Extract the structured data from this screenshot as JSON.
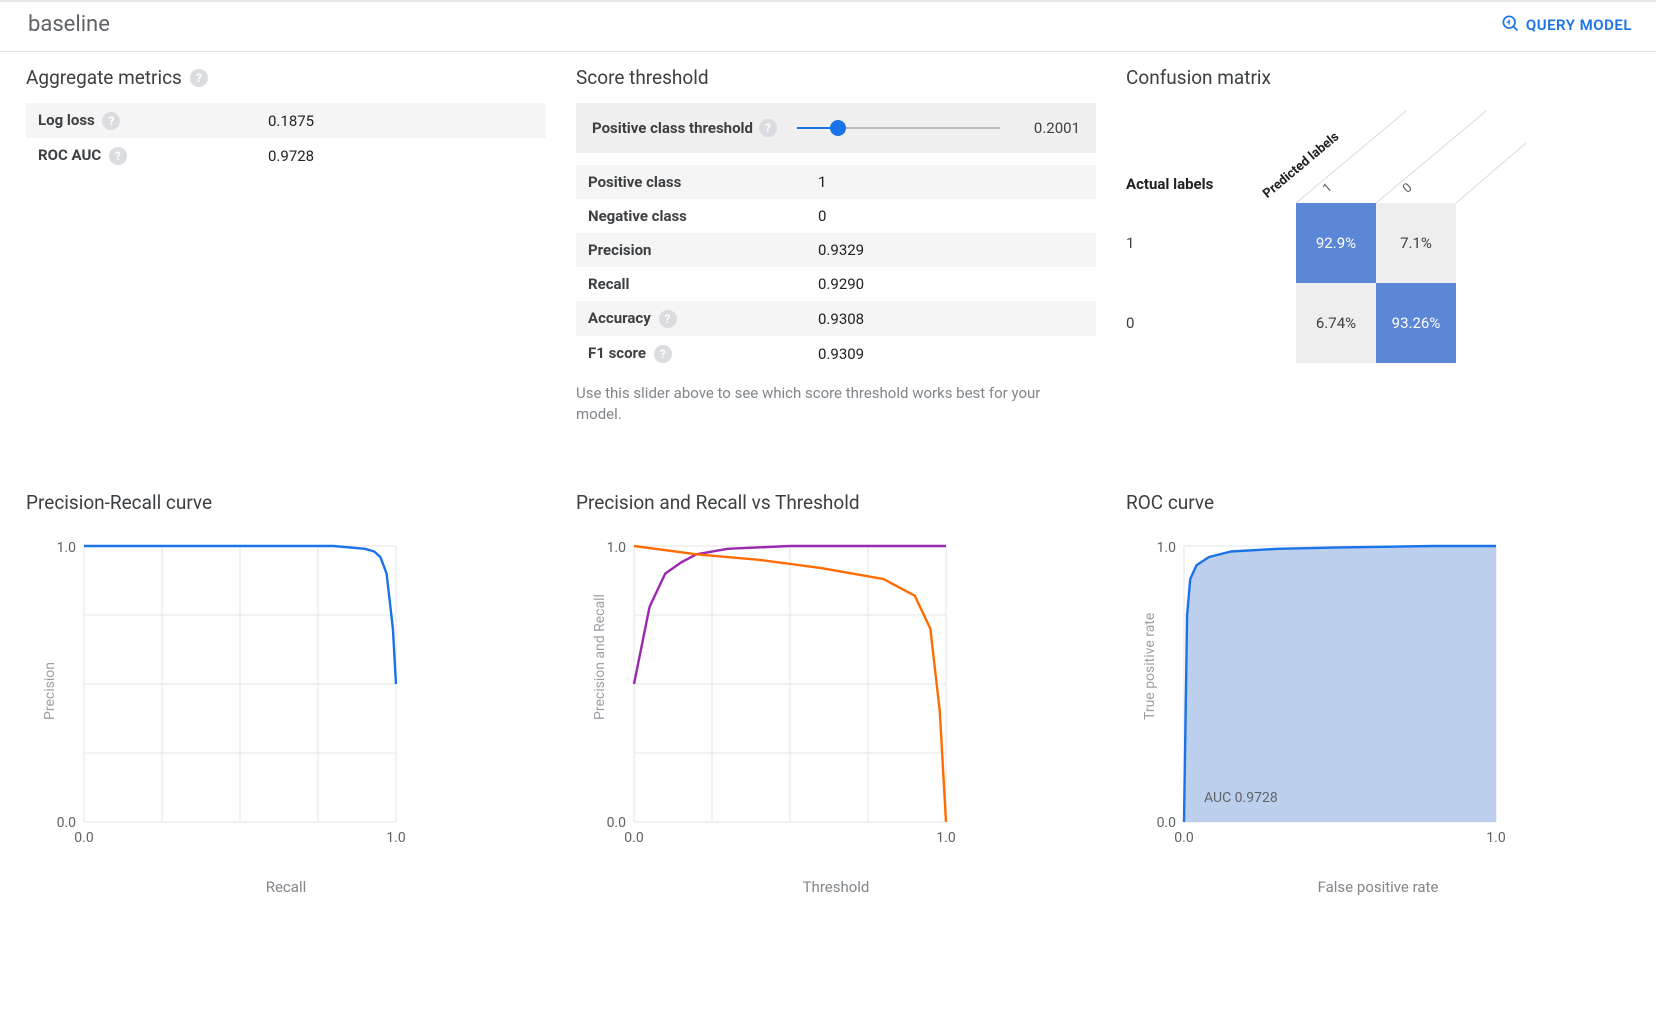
{
  "header": {
    "title": "baseline",
    "query_button": "QUERY MODEL"
  },
  "aggregate": {
    "title": "Aggregate metrics",
    "rows": [
      {
        "label": "Log loss",
        "help": true,
        "value": "0.1875"
      },
      {
        "label": "ROC AUC",
        "help": true,
        "value": "0.9728"
      }
    ]
  },
  "threshold": {
    "title": "Score threshold",
    "slider_label": "Positive class threshold",
    "slider_value": "0.2001",
    "slider_pct": 20,
    "helper": "Use this slider above to see which score threshold works best for your model.",
    "rows": [
      {
        "label": "Positive class",
        "help": false,
        "value": "1"
      },
      {
        "label": "Negative class",
        "help": false,
        "value": "0"
      },
      {
        "label": "Precision",
        "help": false,
        "value": "0.9329"
      },
      {
        "label": "Recall",
        "help": false,
        "value": "0.9290"
      },
      {
        "label": "Accuracy",
        "help": true,
        "value": "0.9308"
      },
      {
        "label": "F1 score",
        "help": true,
        "value": "0.9309"
      }
    ]
  },
  "confusion": {
    "title": "Confusion matrix",
    "actual_label": "Actual labels",
    "predicted_label": "Predicted labels",
    "col_headers": [
      "1",
      "0"
    ],
    "rows": [
      {
        "label": "1",
        "cells": [
          {
            "v": "92.9%",
            "blue": true
          },
          {
            "v": "7.1%",
            "blue": false
          }
        ]
      },
      {
        "label": "0",
        "cells": [
          {
            "v": "6.74%",
            "blue": false
          },
          {
            "v": "93.26%",
            "blue": true
          }
        ]
      }
    ]
  },
  "chart_titles": {
    "pr": "Precision-Recall curve",
    "prt": "Precision and Recall vs Threshold",
    "roc": "ROC curve"
  },
  "axis_labels": {
    "pr_y": "Precision",
    "pr_x": "Recall",
    "prt_y": "Precision and Recall",
    "prt_x": "Threshold",
    "roc_y": "True positive rate",
    "roc_x": "False positive rate"
  },
  "roc_annotation": "AUC 0.9728",
  "ticks": {
    "lo": "0.0",
    "hi": "1.0"
  },
  "chart_data": [
    {
      "type": "line",
      "title": "Precision-Recall curve",
      "xlabel": "Recall",
      "ylabel": "Precision",
      "xlim": [
        0,
        1
      ],
      "ylim": [
        0,
        1
      ],
      "series": [
        {
          "name": "PR",
          "color": "#1a73e8",
          "x": [
            0.0,
            0.2,
            0.4,
            0.6,
            0.8,
            0.9,
            0.93,
            0.95,
            0.97,
            0.99,
            1.0
          ],
          "y": [
            1.0,
            1.0,
            1.0,
            1.0,
            1.0,
            0.99,
            0.98,
            0.96,
            0.9,
            0.7,
            0.5
          ]
        }
      ]
    },
    {
      "type": "line",
      "title": "Precision and Recall vs Threshold",
      "xlabel": "Threshold",
      "ylabel": "Precision and Recall",
      "xlim": [
        0,
        1
      ],
      "ylim": [
        0,
        1
      ],
      "series": [
        {
          "name": "Precision",
          "color": "#9c27b0",
          "x": [
            0.0,
            0.05,
            0.1,
            0.15,
            0.2,
            0.3,
            0.5,
            0.7,
            1.0
          ],
          "y": [
            0.5,
            0.78,
            0.9,
            0.94,
            0.97,
            0.99,
            1.0,
            1.0,
            1.0
          ]
        },
        {
          "name": "Recall",
          "color": "#ff6d00",
          "x": [
            0.0,
            0.2,
            0.4,
            0.6,
            0.8,
            0.9,
            0.95,
            0.98,
            1.0
          ],
          "y": [
            1.0,
            0.97,
            0.95,
            0.92,
            0.88,
            0.82,
            0.7,
            0.4,
            0.0
          ]
        }
      ]
    },
    {
      "type": "area",
      "title": "ROC curve",
      "xlabel": "False positive rate",
      "ylabel": "True positive rate",
      "xlim": [
        0,
        1
      ],
      "ylim": [
        0,
        1
      ],
      "annotations": [
        "AUC 0.9728"
      ],
      "series": [
        {
          "name": "ROC",
          "color": "#1a73e8",
          "fill": "#bcd0ed",
          "x": [
            0.0,
            0.01,
            0.02,
            0.04,
            0.08,
            0.15,
            0.3,
            0.5,
            0.8,
            1.0
          ],
          "y": [
            0.0,
            0.75,
            0.88,
            0.93,
            0.96,
            0.98,
            0.99,
            0.995,
            1.0,
            1.0
          ]
        }
      ]
    }
  ]
}
